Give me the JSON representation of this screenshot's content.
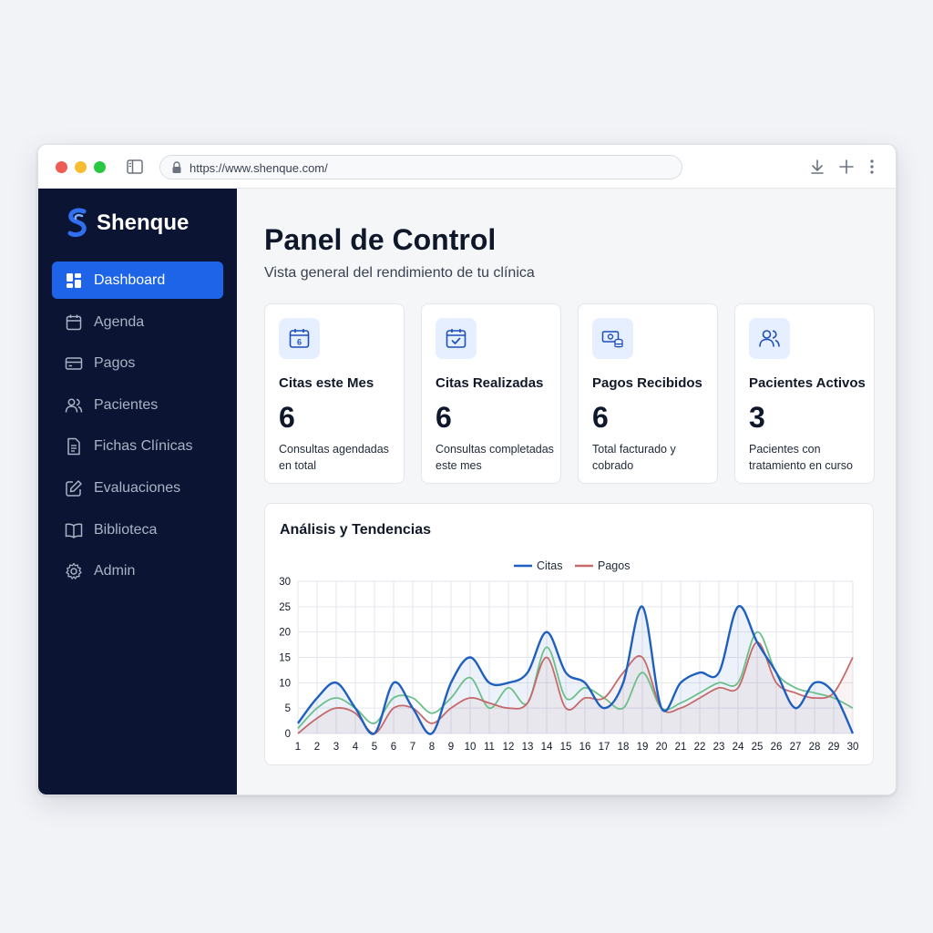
{
  "browser": {
    "url": "https://www.shenque.com/"
  },
  "brand": {
    "name": "Shenque",
    "color": "#1d64e8"
  },
  "sidebar": {
    "items": [
      {
        "label": "Dashboard",
        "icon": "dashboard-icon",
        "active": true
      },
      {
        "label": "Agenda",
        "icon": "calendar-icon",
        "active": false
      },
      {
        "label": "Pagos",
        "icon": "credit-card-icon",
        "active": false
      },
      {
        "label": "Pacientes",
        "icon": "users-icon",
        "active": false
      },
      {
        "label": "Fichas Clínicas",
        "icon": "document-icon",
        "active": false
      },
      {
        "label": "Evaluaciones",
        "icon": "edit-icon",
        "active": false
      },
      {
        "label": "Biblioteca",
        "icon": "book-icon",
        "active": false
      },
      {
        "label": "Admin",
        "icon": "gear-icon",
        "active": false
      }
    ]
  },
  "header": {
    "title": "Panel de Control",
    "subtitle": "Vista general del rendimiento de tu clínica"
  },
  "cards": [
    {
      "title": "Citas este Mes",
      "value": "6",
      "desc": "Consultas agendadas en total",
      "icon": "calendar-day-icon"
    },
    {
      "title": "Citas Realizadas",
      "value": "6",
      "desc": "Consultas completadas este mes",
      "icon": "calendar-check-icon"
    },
    {
      "title": "Pagos Recibidos",
      "value": "6",
      "desc": "Total facturado y cobrado",
      "icon": "money-icon"
    },
    {
      "title": "Pacientes Activos",
      "value": "3",
      "desc": "Pacientes con tratamiento en curso",
      "icon": "users-icon"
    }
  ],
  "analysis": {
    "title": "Análisis y Tendencias"
  },
  "chart_data": {
    "type": "line",
    "title": "",
    "xlabel": "",
    "ylabel": "",
    "x": [
      1,
      2,
      3,
      4,
      5,
      6,
      7,
      8,
      9,
      10,
      11,
      12,
      13,
      14,
      15,
      16,
      17,
      18,
      19,
      20,
      21,
      22,
      23,
      24,
      25,
      26,
      27,
      28,
      29,
      30
    ],
    "ylim": [
      0,
      30
    ],
    "yticks": [
      0,
      5,
      10,
      15,
      20,
      25,
      30
    ],
    "grid": true,
    "legend": "top-center",
    "series": [
      {
        "name": "Citas",
        "color": "#1f5fbf",
        "values": [
          2,
          7,
          10,
          5,
          0,
          10,
          5,
          0,
          10,
          15,
          10,
          10,
          12,
          20,
          12,
          10,
          5,
          10,
          25,
          5,
          10,
          12,
          12,
          25,
          18,
          12,
          5,
          10,
          8,
          0
        ]
      },
      {
        "name": "Pagos",
        "color": "#c46a6a",
        "values": [
          0,
          3,
          5,
          4,
          0,
          5,
          5,
          2,
          5,
          7,
          6,
          5,
          6,
          15,
          5,
          7,
          7,
          12,
          15,
          5,
          5,
          7,
          9,
          9,
          18,
          10,
          8,
          7,
          8,
          15
        ]
      },
      {
        "name": "",
        "color": "#6cbf8a",
        "values": [
          1,
          5,
          7,
          5,
          2,
          7,
          7,
          4,
          7,
          11,
          5,
          9,
          6,
          17,
          7,
          9,
          7,
          5,
          12,
          5,
          6,
          8,
          10,
          10,
          20,
          12,
          9,
          8,
          7,
          5
        ]
      }
    ]
  }
}
